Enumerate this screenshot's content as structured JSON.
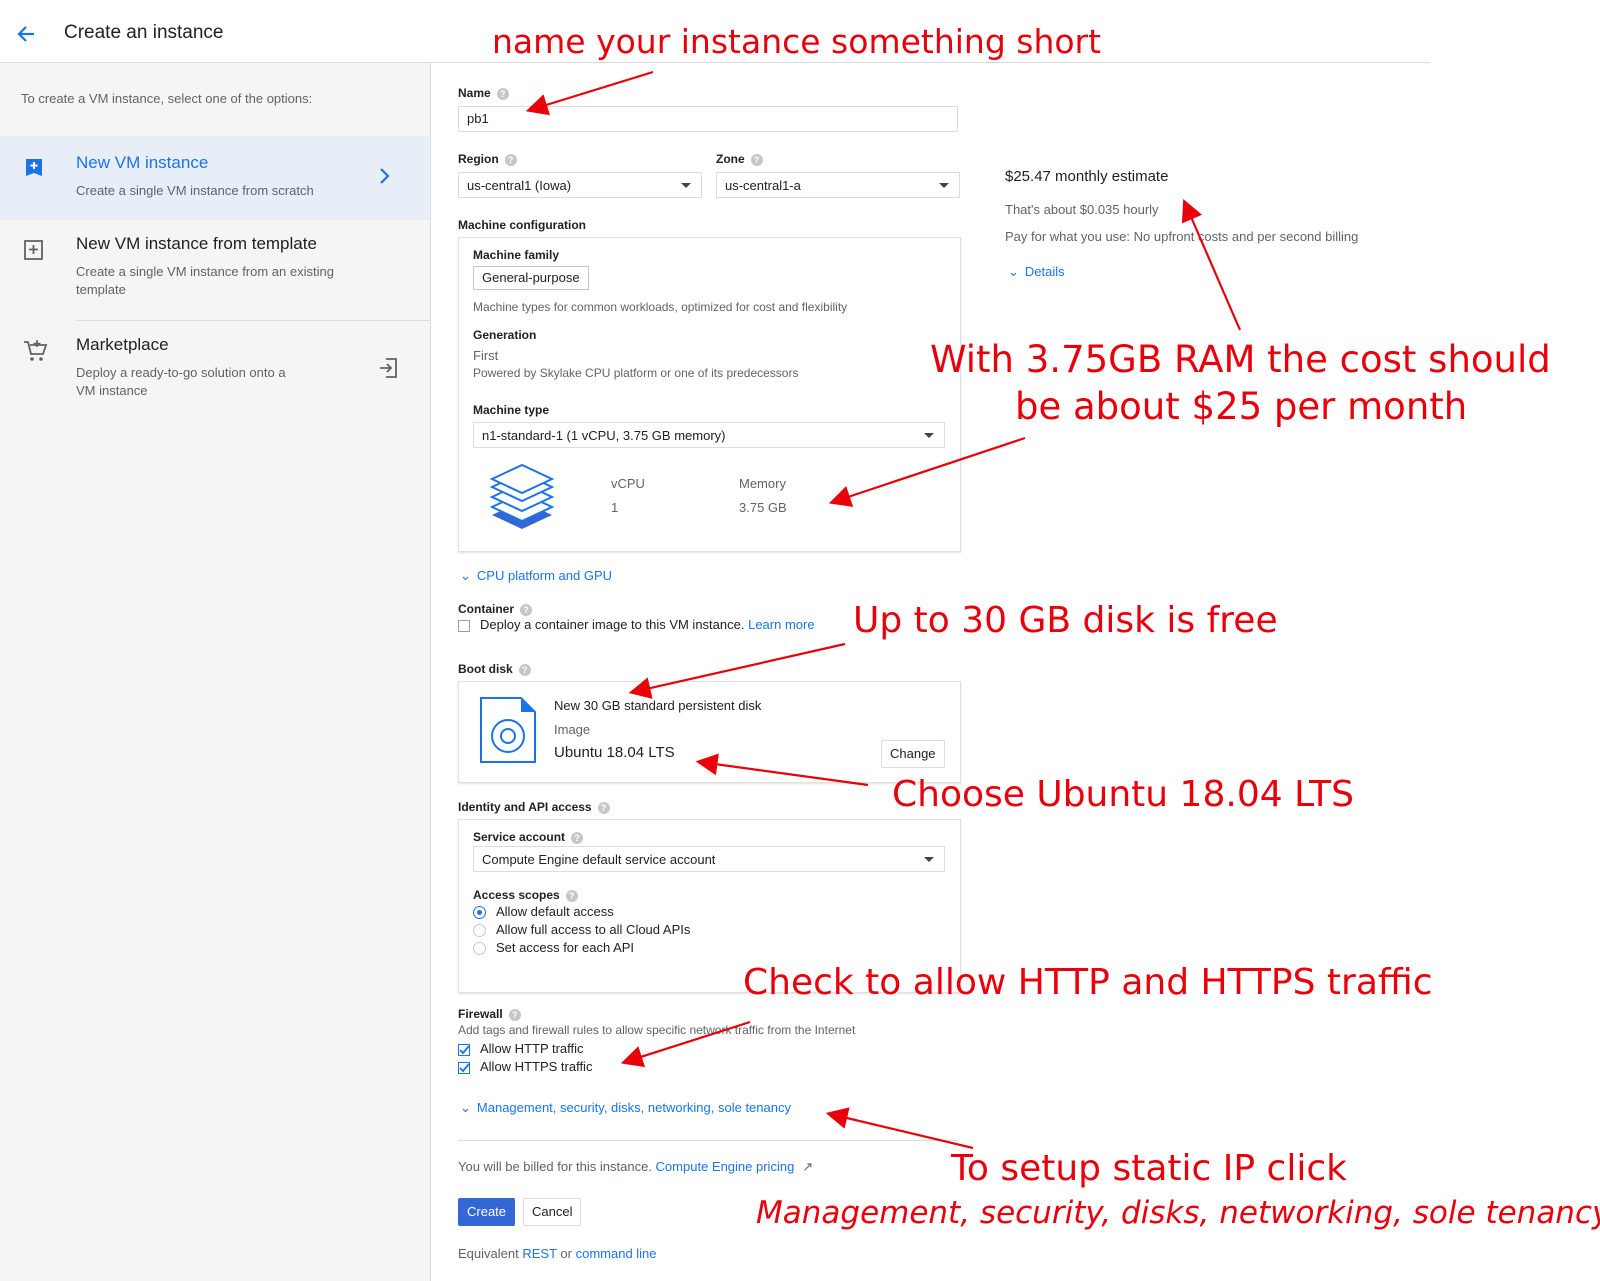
{
  "header": {
    "title": "Create an instance"
  },
  "sidebar": {
    "intro": "To create a VM instance, select one of the options:",
    "options": [
      {
        "title": "New VM instance",
        "desc": "Create a single VM instance from scratch",
        "selected": true
      },
      {
        "title": "New VM instance from template",
        "desc": "Create a single VM instance from an existing template"
      },
      {
        "title": "Marketplace",
        "desc": "Deploy a ready-to-go solution onto a VM instance"
      }
    ]
  },
  "form": {
    "name_label": "Name",
    "name_value": "pb1",
    "region_label": "Region",
    "region_value": "us-central1 (Iowa)",
    "zone_label": "Zone",
    "zone_value": "us-central1-a",
    "machine_config_label": "Machine configuration",
    "machine_family_label": "Machine family",
    "machine_family_value": "General-purpose",
    "machine_family_desc": "Machine types for common workloads, optimized for cost and flexibility",
    "generation_label": "Generation",
    "generation_value": "First",
    "generation_desc": "Powered by Skylake CPU platform or one of its predecessors",
    "machine_type_label": "Machine type",
    "machine_type_value": "n1-standard-1 (1 vCPU, 3.75 GB memory)",
    "vcpu_label": "vCPU",
    "vcpu_value": "1",
    "memory_label": "Memory",
    "memory_value": "3.75 GB",
    "cpu_gpu_link": "CPU platform and GPU",
    "container_label": "Container",
    "container_desc": "Deploy a container image to this VM instance.",
    "learn_more": "Learn more",
    "boot_disk_label": "Boot disk",
    "boot_disk_title": "New 30 GB standard persistent disk",
    "image_label": "Image",
    "image_value": "Ubuntu 18.04 LTS",
    "change_button": "Change",
    "identity_label": "Identity and API access",
    "service_account_label": "Service account",
    "service_account_value": "Compute Engine default service account",
    "access_scopes_label": "Access scopes",
    "scopes": [
      "Allow default access",
      "Allow full access to all Cloud APIs",
      "Set access for each API"
    ],
    "firewall_label": "Firewall",
    "firewall_desc": "Add tags and firewall rules to allow specific network traffic from the Internet",
    "allow_http": "Allow HTTP traffic",
    "allow_https": "Allow HTTPS traffic",
    "management_link": "Management, security, disks, networking, sole tenancy",
    "billing_text": "You will be billed for this instance.",
    "pricing_link": "Compute Engine pricing",
    "create_button": "Create",
    "cancel_button": "Cancel",
    "equivalent_text": "Equivalent",
    "rest_link": "REST",
    "or_text": "or",
    "command_line_link": "command line"
  },
  "estimate": {
    "monthly": "$25.47 monthly estimate",
    "hourly": "That's about $0.035 hourly",
    "note": "Pay for what you use: No upfront costs and per second billing",
    "details_link": "Details"
  },
  "annotations": {
    "name": "name your instance something short",
    "ram_line1": "With 3.75GB RAM the cost should",
    "ram_line2": "be about $25 per month",
    "disk": "Up to 30 GB disk is free",
    "ubuntu": "Choose Ubuntu 18.04 LTS",
    "http": "Check to allow HTTP and HTTPS traffic",
    "static_ip": "To setup static IP click",
    "static_ip_detail": "Management, security, disks, networking, sole tenancy"
  },
  "colors": {
    "accent": "#1a73e8",
    "annotation": "#e8000b",
    "primary_button": "#3367d6"
  }
}
